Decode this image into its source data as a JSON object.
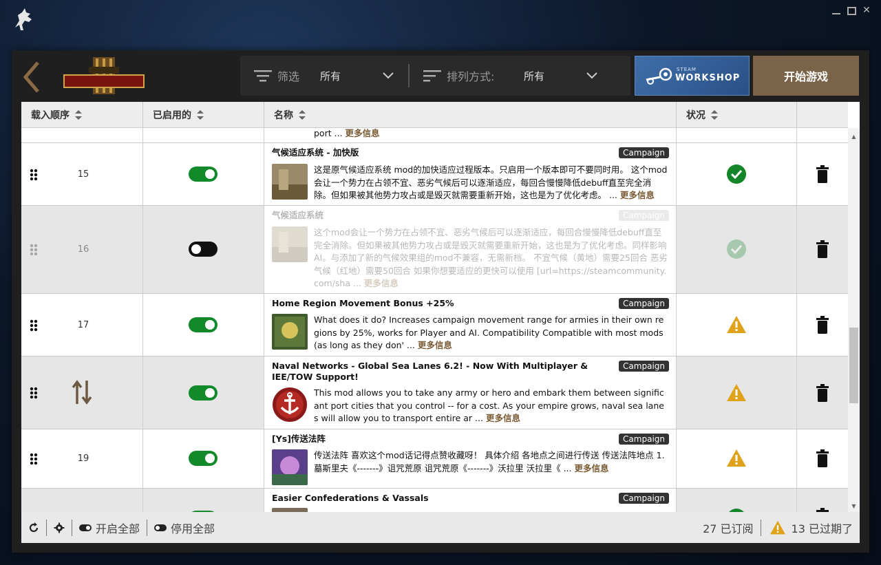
{
  "header": {
    "filter_label": "筛选",
    "filter_value": "所有",
    "sort_label": "排列方式:",
    "sort_value": "所有",
    "workshop_steam": "STEAM",
    "workshop_label": "WORKSHOP",
    "play_label": "开始游戏"
  },
  "columns": {
    "order": "载入顺序",
    "enabled": "已启用的",
    "name": "名称",
    "status": "状况"
  },
  "partial_top": {
    "desc": "port ...",
    "more": "更多信息"
  },
  "mods": [
    {
      "order": "15",
      "enabled": true,
      "title": "气候适应系统 - 加快版",
      "badge": "Campaign",
      "desc": "这是原气候适应系统 mod的加快适应过程版本。只启用一个版本即可不要同时用。 这个mod会让一个势力在占领不宜、恶劣气候后可以逐渐适应，每回合慢慢降低debuff直至完全消除。但如果被其他势力攻占或是毁灭就需要重新开始，这也是为了优化考虑。 ...",
      "more": "更多信息",
      "status": "ok"
    },
    {
      "order": "16",
      "enabled": false,
      "title": "气候适应系统",
      "badge": "Campaign",
      "desc": "这个mod会让一个势力在占领不宜、恶劣气候后可以逐渐适应，每回合慢慢降低debuff直至完全消除。但如果被其他势力攻占或是毁灭就需要重新开始，这也是为了优化考虑。同样影响AI。与添加了新的气候效果组的mod不兼容，无需新档。 不宜气候（黄地）需要25回合 恶劣气候（红地）需要50回合 如果你想要适应的更快可以使用 [url=https://steamcommunity.com/sha ...",
      "more": "更多信息",
      "status": "ok"
    },
    {
      "order": "17",
      "enabled": true,
      "title": "Home Region Movement Bonus +25%",
      "badge": "Campaign",
      "desc": "What does it do? Increases campaign movement range for armies in their own regions by 25%, works for Player and AI. Compatibility Compatible with most mods (as long as they don' ...",
      "more": "更多信息",
      "status": "warning"
    },
    {
      "order": "",
      "enabled": true,
      "title": "Naval Networks - Global Sea Lanes 6.2! - Now With Multiplayer & IEE/TOW Support!",
      "badge": "Campaign",
      "desc": "This mod allows you to take any army or hero and embark them between significant port cities that you control -- for a cost. As your empire grows, naval sea lanes will allow you to transport entire ar ...",
      "more": "更多信息",
      "status": "warning"
    },
    {
      "order": "19",
      "enabled": true,
      "title": "[Ys]传送法阵",
      "badge": "Campaign",
      "desc": "传送法阵 喜欢这个mod话记得点赞收藏呀！ 具体介绍 各地点之间进行传送 传送法阵地点 1.墓斯里夫《-------》诅咒荒原 诅咒荒原《-------》沃拉里 沃拉里《 ...",
      "more": "更多信息",
      "status": "warning"
    },
    {
      "order": "",
      "enabled": true,
      "title": "Easier Confederations & Vassals",
      "badge": "Campaign",
      "desc": "",
      "more": "",
      "status": "ok"
    }
  ],
  "footer": {
    "enable_all": "开启全部",
    "disable_all": "停用全部",
    "subscribed": "27 已订阅",
    "outdated": "13 已过期了"
  },
  "colors": {
    "accent_brown": "#7a6348",
    "toggle_on": "#138a2a",
    "status_ok": "#15852a",
    "status_warning": "#e0a11b"
  }
}
